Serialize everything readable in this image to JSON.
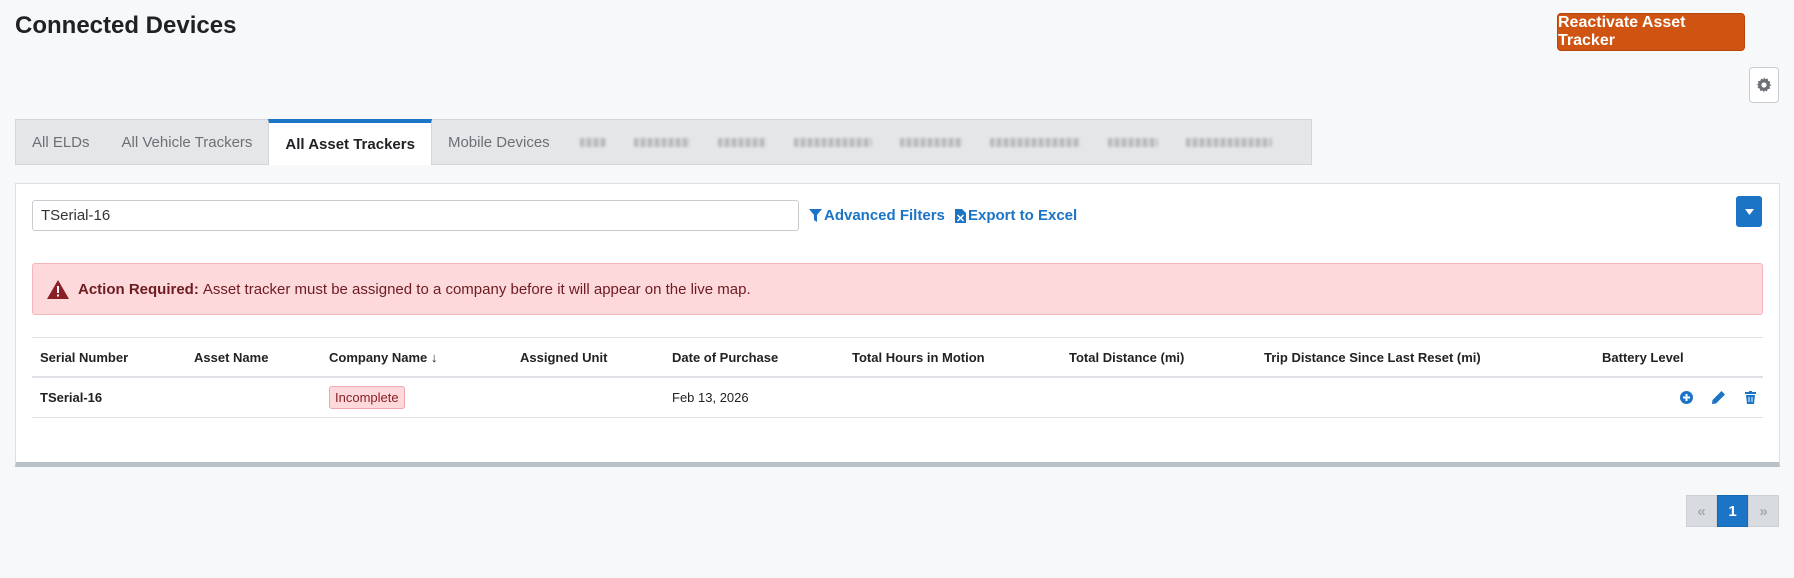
{
  "page": {
    "title": "Connected Devices"
  },
  "header": {
    "reactivate_label": "Reactivate Asset Tracker"
  },
  "tabs": [
    {
      "label": "All ELDs"
    },
    {
      "label": "All Vehicle Trackers"
    },
    {
      "label": "All Asset Trackers",
      "active": true
    },
    {
      "label": "Mobile Devices"
    }
  ],
  "search": {
    "value": "TSerial-16",
    "placeholder": ""
  },
  "toolbar": {
    "advanced_filters_label": "Advanced Filters",
    "export_label": "Export to Excel"
  },
  "alert": {
    "title": "Action Required:",
    "message": "Asset tracker must be assigned to a company before it will appear on the live map."
  },
  "table": {
    "columns": [
      "Serial Number",
      "Asset Name",
      "Company Name ↓",
      "Assigned Unit",
      "Date of Purchase",
      "Total Hours in Motion",
      "Total Distance (mi)",
      "Trip Distance Since Last Reset (mi)",
      "Battery Level"
    ],
    "rows": [
      {
        "serial_number": "TSerial-16",
        "asset_name": "",
        "company_name": "Incomplete",
        "assigned_unit": "",
        "date_of_purchase": "Feb 13, 2026",
        "total_hours_in_motion": "",
        "total_distance": "",
        "trip_distance": "",
        "battery_level": ""
      }
    ]
  },
  "pagination": {
    "prev": "«",
    "current": "1",
    "next": "»"
  },
  "colors": {
    "accent": "#1b74c5",
    "primary_button": "#cf5311",
    "alert_bg": "#fdd9db"
  }
}
